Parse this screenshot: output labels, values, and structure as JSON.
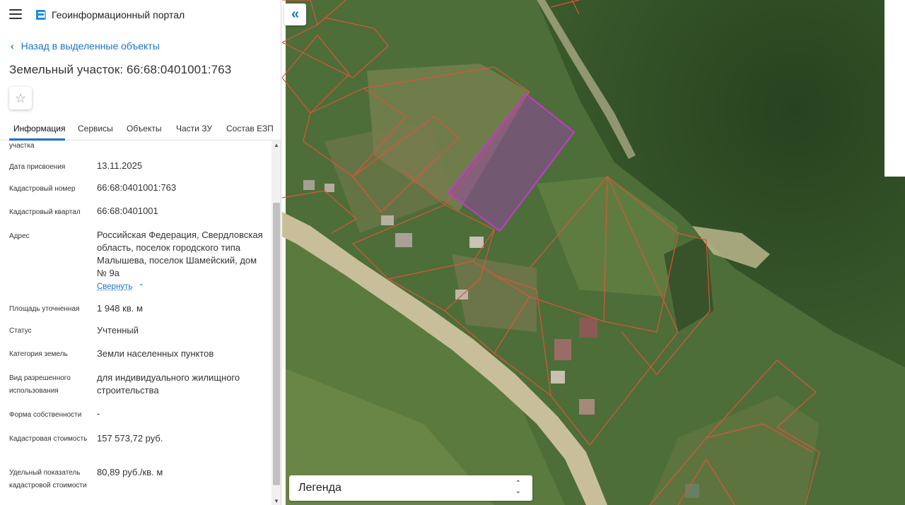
{
  "header": {
    "app_title": "Геоинформационный портал",
    "menu_icon": "menu-icon",
    "logo_icon": "portal-logo-icon"
  },
  "nav": {
    "back_label": "Назад в выделенные объекты"
  },
  "object": {
    "title": "Земельный участок: 66:68:0401001:763"
  },
  "tabs": [
    {
      "label": "Информация",
      "active": true
    },
    {
      "label": "Сервисы",
      "active": false
    },
    {
      "label": "Объекты",
      "active": false
    },
    {
      "label": "Части ЗУ",
      "active": false
    },
    {
      "label": "Состав ЕЗП",
      "active": false
    }
  ],
  "info": {
    "partial_label": "участка",
    "rows": [
      {
        "label": "Дата присвоения",
        "value": "13.11.2025"
      },
      {
        "label": "Кадастровый номер",
        "value": "66:68:0401001:763"
      },
      {
        "label": "Кадастровый квартал",
        "value": "66:68:0401001"
      },
      {
        "label": "Адрес",
        "value": "Российская Федерация, Свердловская область, поселок городского типа Малышева, поселок Шамейский, дом № 9а"
      },
      {
        "label": "Площадь уточненная",
        "value": "1 948 кв. м"
      },
      {
        "label": "Статус",
        "value": "Учтенный"
      },
      {
        "label": "Категория земель",
        "value": "Земли населенных пунктов"
      },
      {
        "label": "Вид разрешенного использования",
        "value": "для индивидуального жилищного строительства"
      },
      {
        "label": "Форма собственности",
        "value": "-"
      },
      {
        "label": "Кадастровая стоимость",
        "value": "157 573,72 руб."
      },
      {
        "label": "Удельный показатель кадастровой стоимости",
        "value": "80,89 руб./кв. м"
      }
    ],
    "collapse_label": "Свернуть"
  },
  "map": {
    "collapse_button": "«",
    "legend_label": "Легенда",
    "parcel_border_color": "#e0533a",
    "selected_parcel_color": "#a03fb5"
  }
}
